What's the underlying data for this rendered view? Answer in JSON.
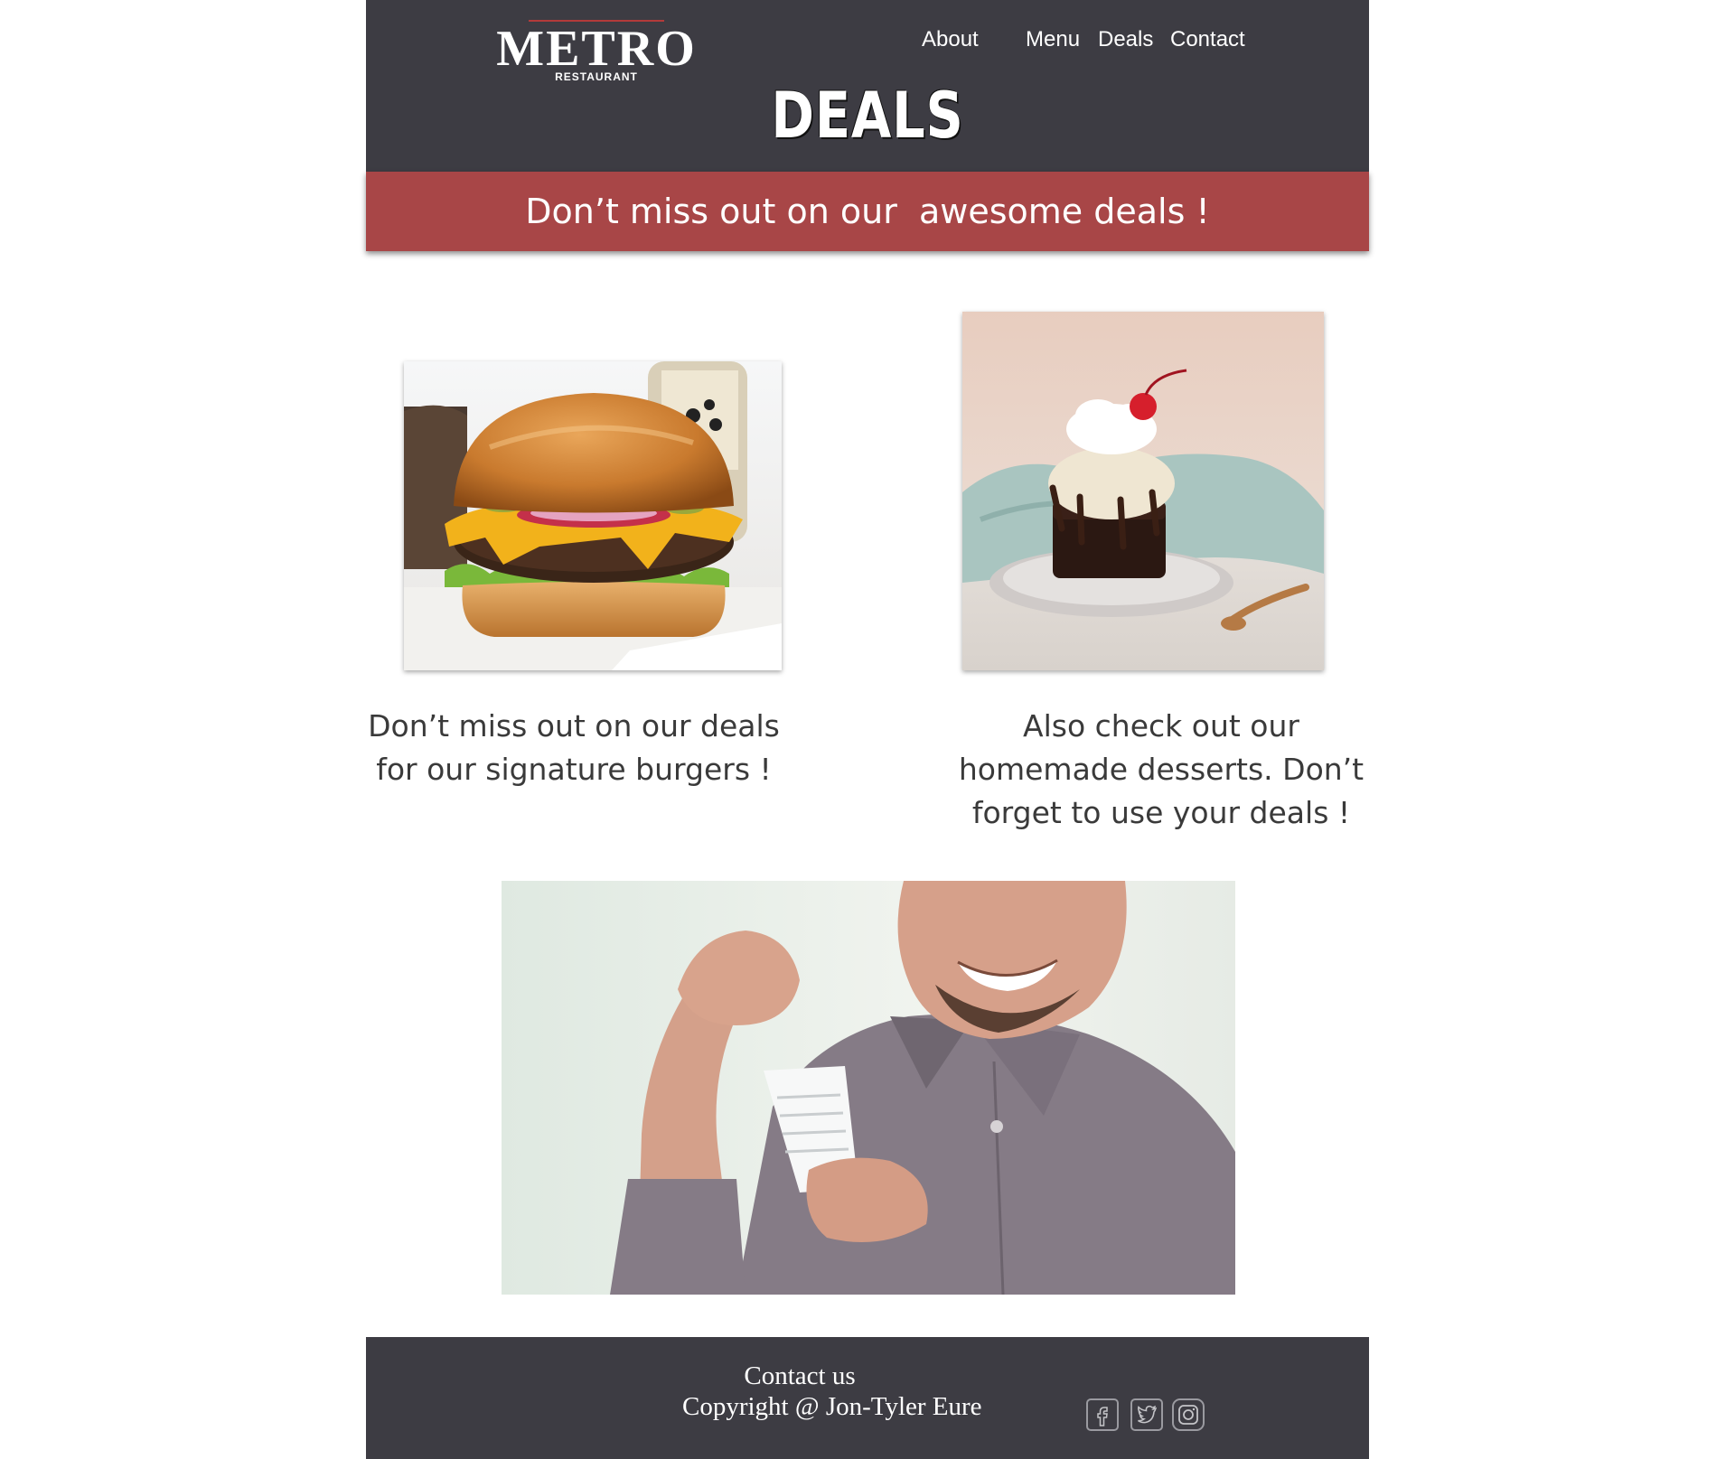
{
  "header": {
    "logo_main": "METRO",
    "logo_sub": "RESTAURANT",
    "nav": [
      {
        "label": "About"
      },
      {
        "label": "Menu"
      },
      {
        "label": "Deals"
      },
      {
        "label": "Contact"
      }
    ],
    "page_heading": "DEALS"
  },
  "banner": {
    "text": "Don’t miss out on our  awesome deals !"
  },
  "cards": [
    {
      "image_icon": "burger-photo",
      "caption_line1": "Don’t miss out on our deals",
      "caption_line2": "for our signature burgers !"
    },
    {
      "image_icon": "dessert-photo",
      "caption_line1": "Also check out our",
      "caption_line2": "homemade desserts. Don’t",
      "caption_line3": "forget to use your deals !"
    }
  ],
  "hero_image": {
    "image_icon": "happy-man-receipt-photo"
  },
  "footer": {
    "contact": "Contact us",
    "copyright": "Copyright @ Jon-Tyler Eure",
    "social": [
      {
        "icon": "facebook-icon"
      },
      {
        "icon": "twitter-icon"
      },
      {
        "icon": "instagram-icon"
      }
    ]
  },
  "colors": {
    "header_bg": "#3d3c43",
    "banner_bg": "#a84647",
    "text": "#3a3a3a"
  }
}
